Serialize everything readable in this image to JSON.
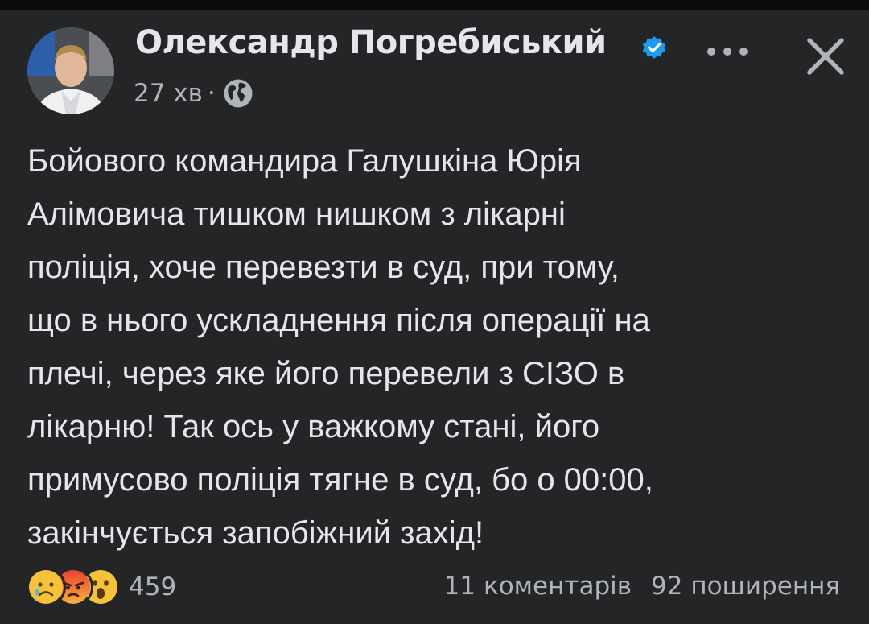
{
  "post": {
    "author": "Олександр Погребиський",
    "verified": true,
    "time": "27 хв",
    "separator": "·",
    "privacy_icon": "globe-icon",
    "more_icon": "more-dots-icon",
    "close_icon": "close-icon",
    "text_lines": [
      "Бойового командира Галушкіна Юрія",
      "Алімовича тишком нишком з лікарні",
      "поліція, хоче перевезти в суд, при тому,",
      "що в нього ускладнення після операції на",
      "плечі, через яке його перевели з СІЗО в",
      "лікарню! Так ось у важкому стані, його",
      "примусово поліція тягне в суд, бо о 00:00,",
      "закінчується запобіжний захід!"
    ]
  },
  "footer": {
    "reactions": [
      "sad",
      "angry",
      "wow"
    ],
    "reaction_count": "459",
    "comments": "11 коментарів",
    "shares": "92 поширення"
  },
  "colors": {
    "background": "#242526",
    "text": "#e4e6eb",
    "secondary": "#b0b3b8",
    "verified": "#1d9bf0"
  }
}
